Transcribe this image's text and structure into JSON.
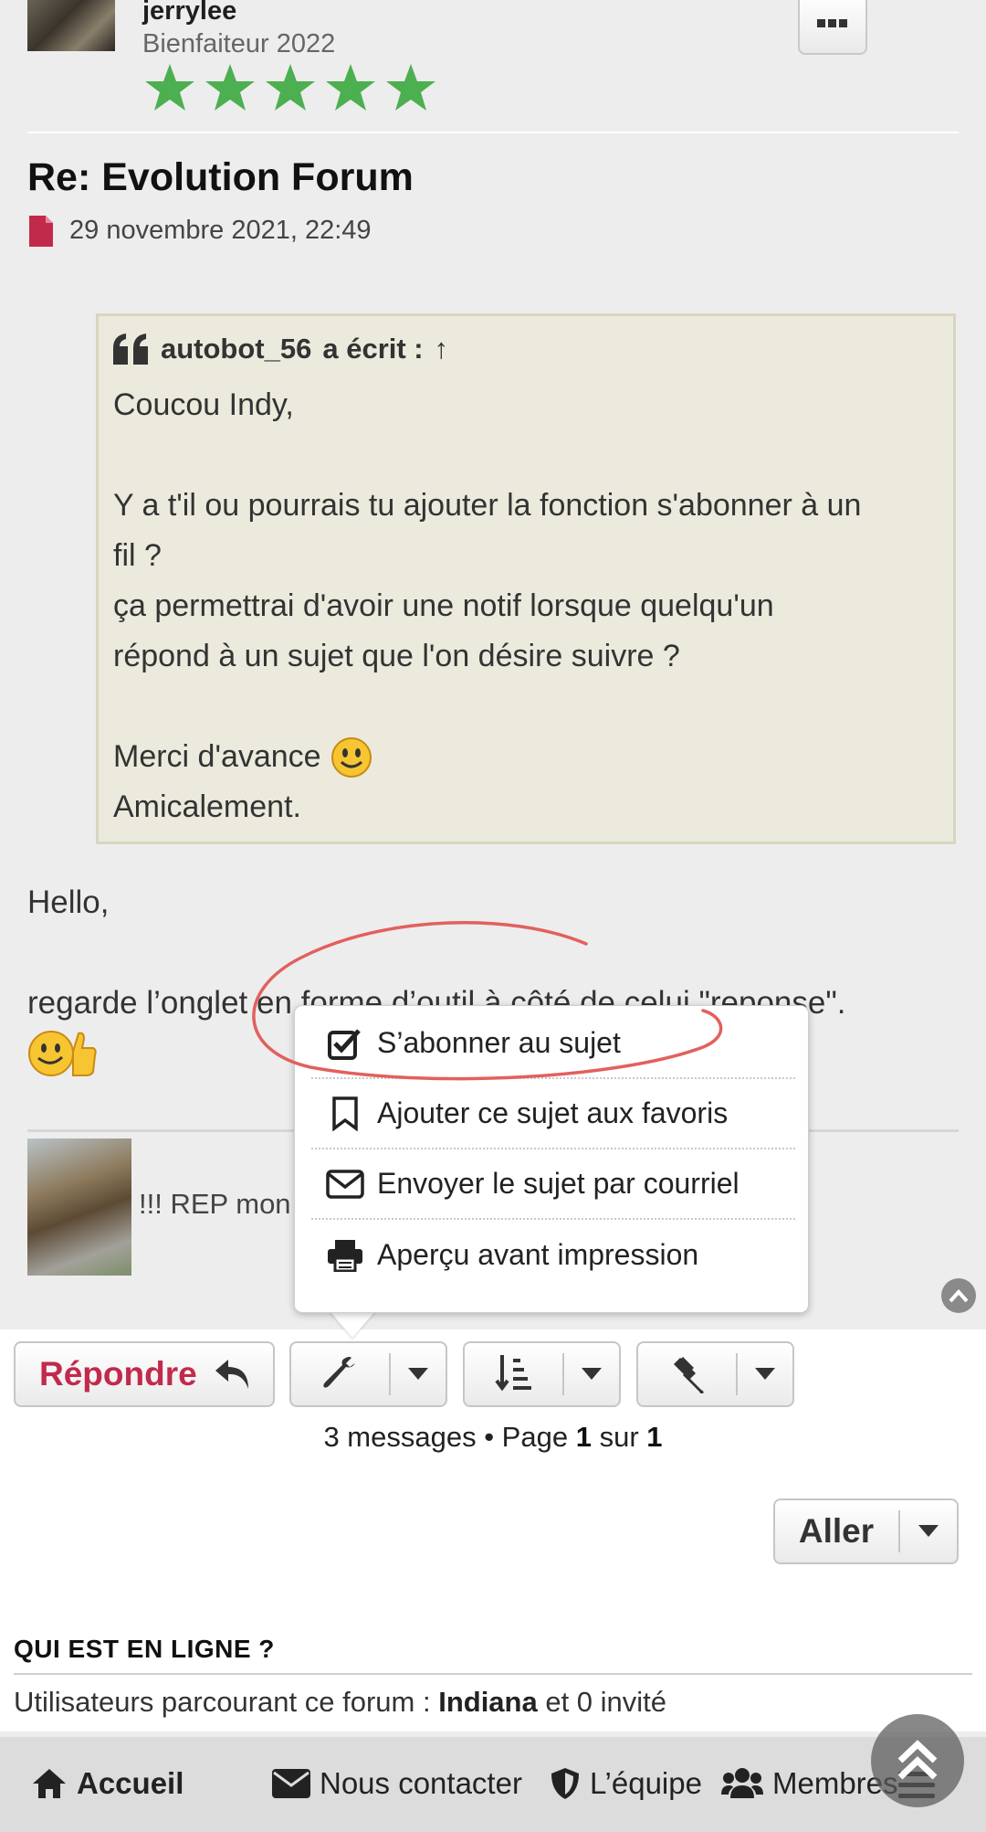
{
  "post": {
    "username": "jerrylee",
    "rank": "Bienfaiteur 2022",
    "title": "Re: Evolution Forum",
    "date": "29 novembre 2021, 22:49",
    "quote": {
      "author": "autobot_56",
      "wrote": "a écrit :",
      "arrow": "↑",
      "lines": [
        "Coucou Indy,",
        "",
        "Y a t'il ou pourrais tu ajouter la fonction s'abonner à un",
        "fil ?",
        "ça permettrai d'avoir une notif lorsque quelqu'un",
        "répond à un sujet que l'on désire suivre ?",
        "",
        "Merci d'avance",
        "Amicalement."
      ]
    },
    "reply_lines": [
      "Hello,",
      "",
      "regarde l’onglet en forme d’outil à côté de celui \"reponse\"."
    ],
    "signature": "!!! REP mon"
  },
  "dropdown": {
    "items": [
      {
        "icon": "checkbox-icon",
        "label": "S’abonner au sujet"
      },
      {
        "icon": "bookmark-icon",
        "label": "Ajouter ce sujet aux favoris"
      },
      {
        "icon": "envelope-icon",
        "label": "Envoyer le sujet par courriel"
      },
      {
        "icon": "printer-icon",
        "label": "Aperçu avant impression"
      }
    ]
  },
  "toolbar": {
    "reply_label": "Répondre"
  },
  "pagination": {
    "messages": "3 messages • Page",
    "current": "1",
    "of": "sur",
    "total": "1"
  },
  "jump": {
    "label": "Aller"
  },
  "online": {
    "title": "QUI EST EN LIGNE ?",
    "prefix": "Utilisateurs parcourant ce forum :",
    "user": "Indiana",
    "suffix": "et 0 invité"
  },
  "bottom_nav": {
    "home": "Accueil",
    "contact": "Nous contacter",
    "team": "L’équipe",
    "members": "Membres"
  },
  "colors": {
    "accent_red": "#c22a4b",
    "star_green": "#4caf50",
    "quote_bg": "#ebeadd",
    "annotation_red": "#e2605d"
  }
}
